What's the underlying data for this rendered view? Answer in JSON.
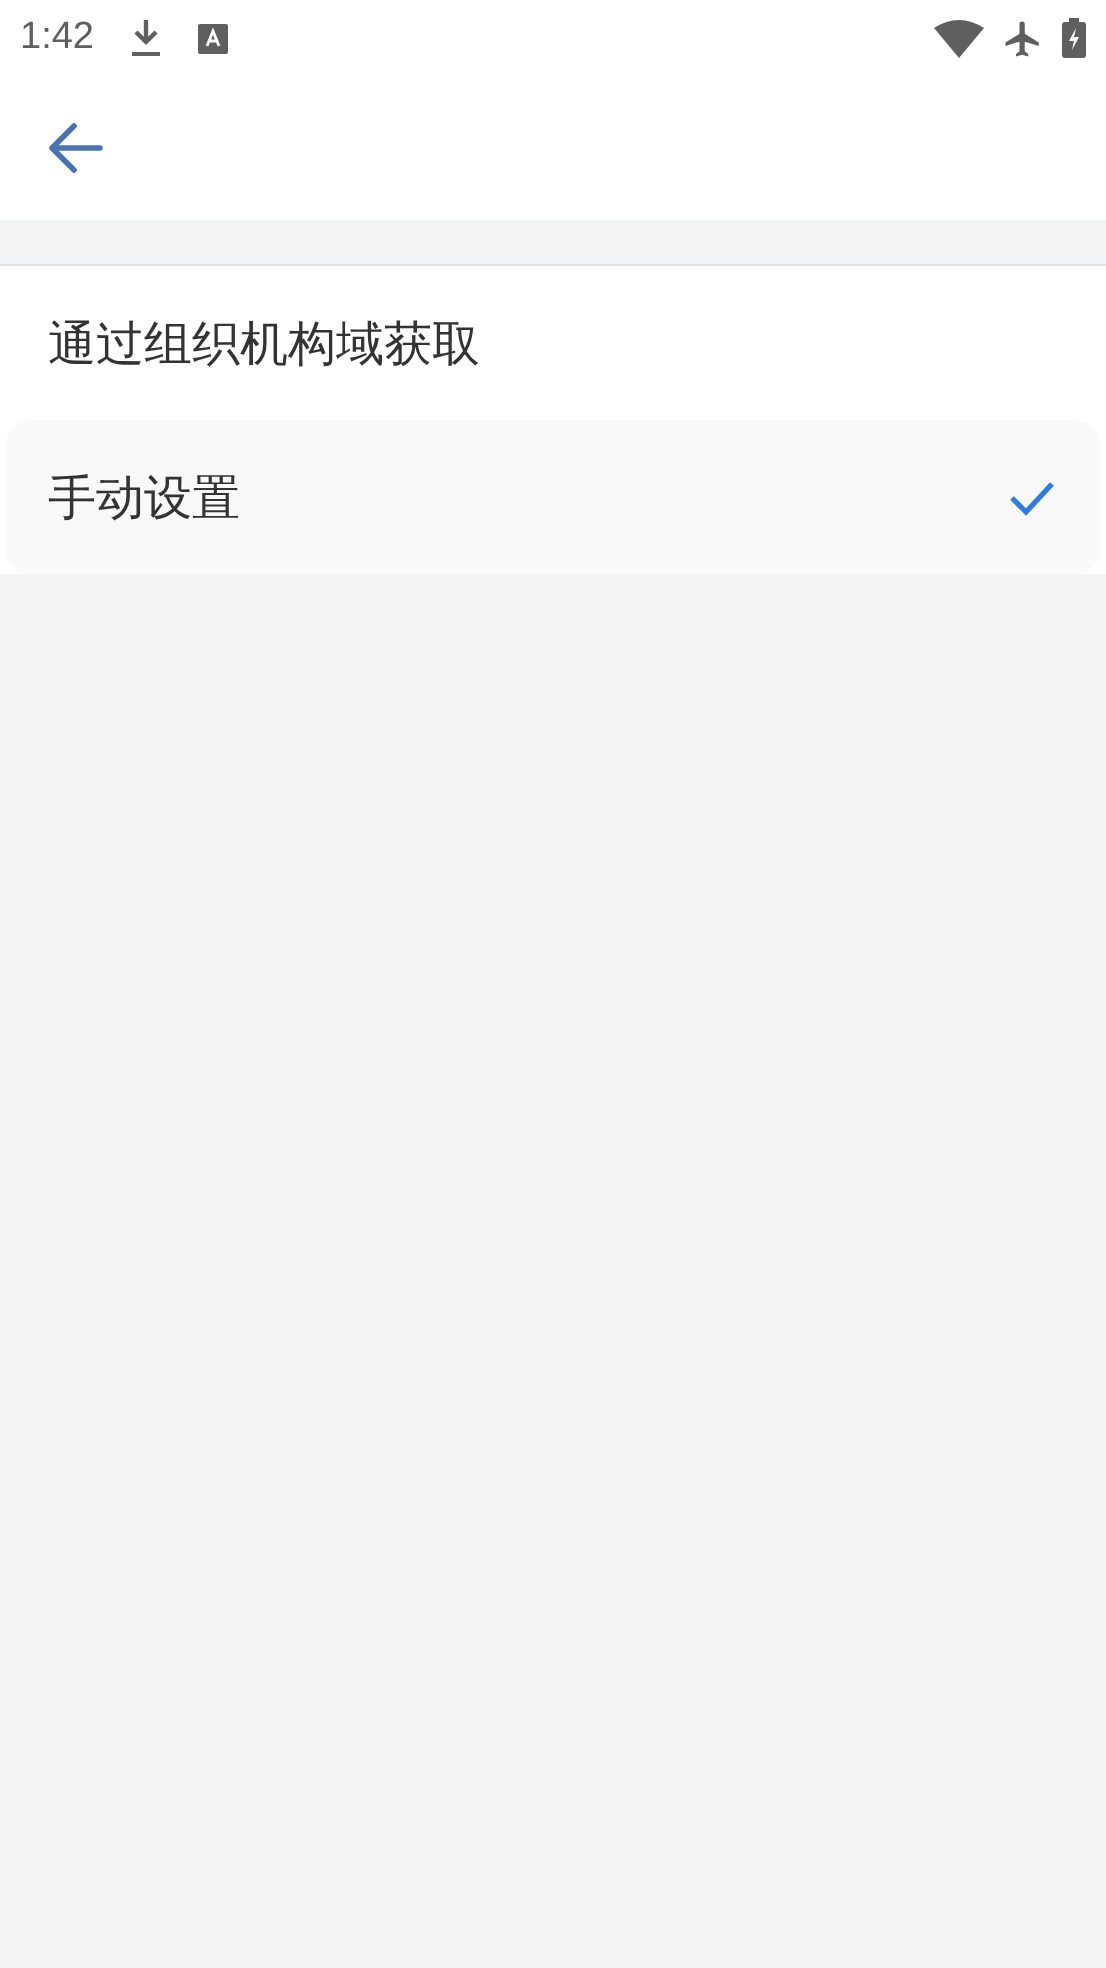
{
  "status_bar": {
    "time": "1:42"
  },
  "options": [
    {
      "label": "通过组织机构域获取",
      "selected": false
    },
    {
      "label": "手动设置",
      "selected": true
    }
  ]
}
